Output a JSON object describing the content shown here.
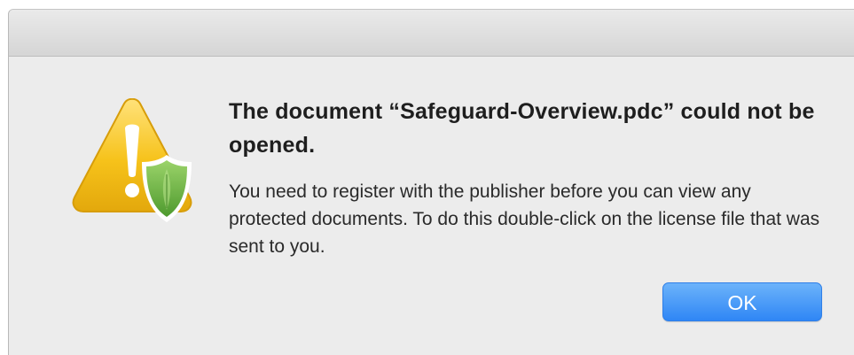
{
  "dialog": {
    "title": "The document “Safeguard-Overview.pdc” could not be opened.",
    "message": "You need to register with the publisher before you can view any protected documents. To do this double-click on the license file that was sent to you.",
    "ok_label": "OK",
    "icon": "warning-shield-icon"
  },
  "colors": {
    "button_accent": "#3b8ff6",
    "warning_yellow": "#f5c518",
    "shield_green": "#6fb24a"
  }
}
